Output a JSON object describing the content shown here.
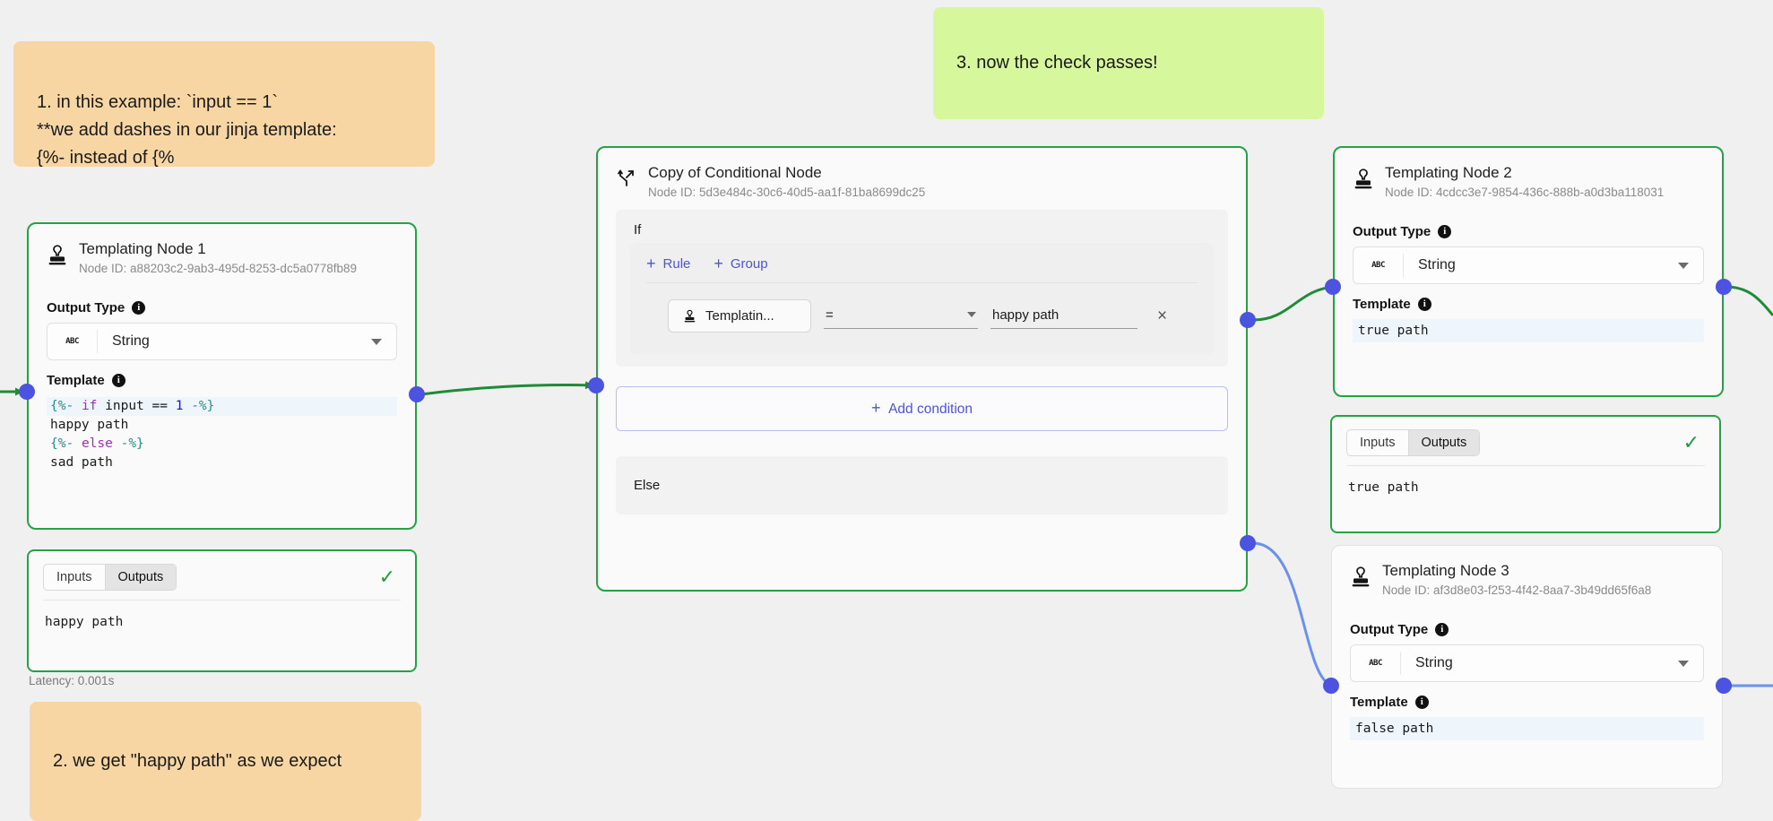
{
  "canvas": {
    "background": "#f0f0f0"
  },
  "colors": {
    "executed_border": "#25a244",
    "executed_edge": "#1f9b3c",
    "idle_edge": "#6b91f0",
    "port": "#4b53e0",
    "accent_link": "#4b53e0",
    "note_orange": "#f7d6a3",
    "note_green": "#d6f79b",
    "check_green": "#1f9b3c"
  },
  "notes": [
    {
      "id": "note-1",
      "text": "1. in this example: `input == 1`\n**we add dashes in our jinja template:\n{%- instead of {%",
      "color": "orange"
    },
    {
      "id": "note-2",
      "text": "2. we get \"happy path\" as we expect",
      "color": "orange"
    },
    {
      "id": "note-3",
      "text": "3. now the check passes!",
      "color": "green"
    }
  ],
  "node1": {
    "title": "Templating Node 1",
    "id_label": "Node ID:",
    "id_value": "a88203c2-9ab3-495d-8253-dc5a0778fb89",
    "output_type_label": "Output Type",
    "output_type_value": "String",
    "type_badge": "ABC",
    "template_label": "Template",
    "template_lines": [
      "{%- if input == 1 -%}",
      "happy path",
      "{%- else -%}",
      "sad path"
    ],
    "icon": "stamp-icon"
  },
  "node1_result": {
    "tab_inputs": "Inputs",
    "tab_outputs": "Outputs",
    "active_tab": "Outputs",
    "value": "happy path",
    "status": "success",
    "latency": "Latency:  0.001s"
  },
  "conditional": {
    "title": "Copy of Conditional Node",
    "id_label": "Node ID:",
    "id_value": "5d3e484c-30c6-40d5-aa1f-81ba8699dc25",
    "if_label": "If",
    "add_rule_label": "Rule",
    "add_group_label": "Group",
    "rule": {
      "source": "Templatin...",
      "operator": "=",
      "value": "happy path",
      "remove_label": "×"
    },
    "add_condition_label": "Add condition",
    "else_label": "Else",
    "icon": "branch-icon"
  },
  "node2": {
    "title": "Templating Node 2",
    "id_label": "Node ID:",
    "id_value": "4cdcc3e7-9854-436c-888b-a0d3ba118031",
    "output_type_label": "Output Type",
    "output_type_value": "String",
    "type_badge": "ABC",
    "template_label": "Template",
    "template_value": "true path",
    "icon": "stamp-icon"
  },
  "node2_result": {
    "tab_inputs": "Inputs",
    "tab_outputs": "Outputs",
    "active_tab": "Outputs",
    "value": "true path",
    "status": "success"
  },
  "node3": {
    "title": "Templating Node 3",
    "id_label": "Node ID:",
    "id_value": "af3d8e03-f253-4f42-8aa7-3b49dd65f6a8",
    "output_type_label": "Output Type",
    "output_type_value": "String",
    "type_badge": "ABC",
    "template_label": "Template",
    "template_value": "false path",
    "icon": "stamp-icon"
  }
}
